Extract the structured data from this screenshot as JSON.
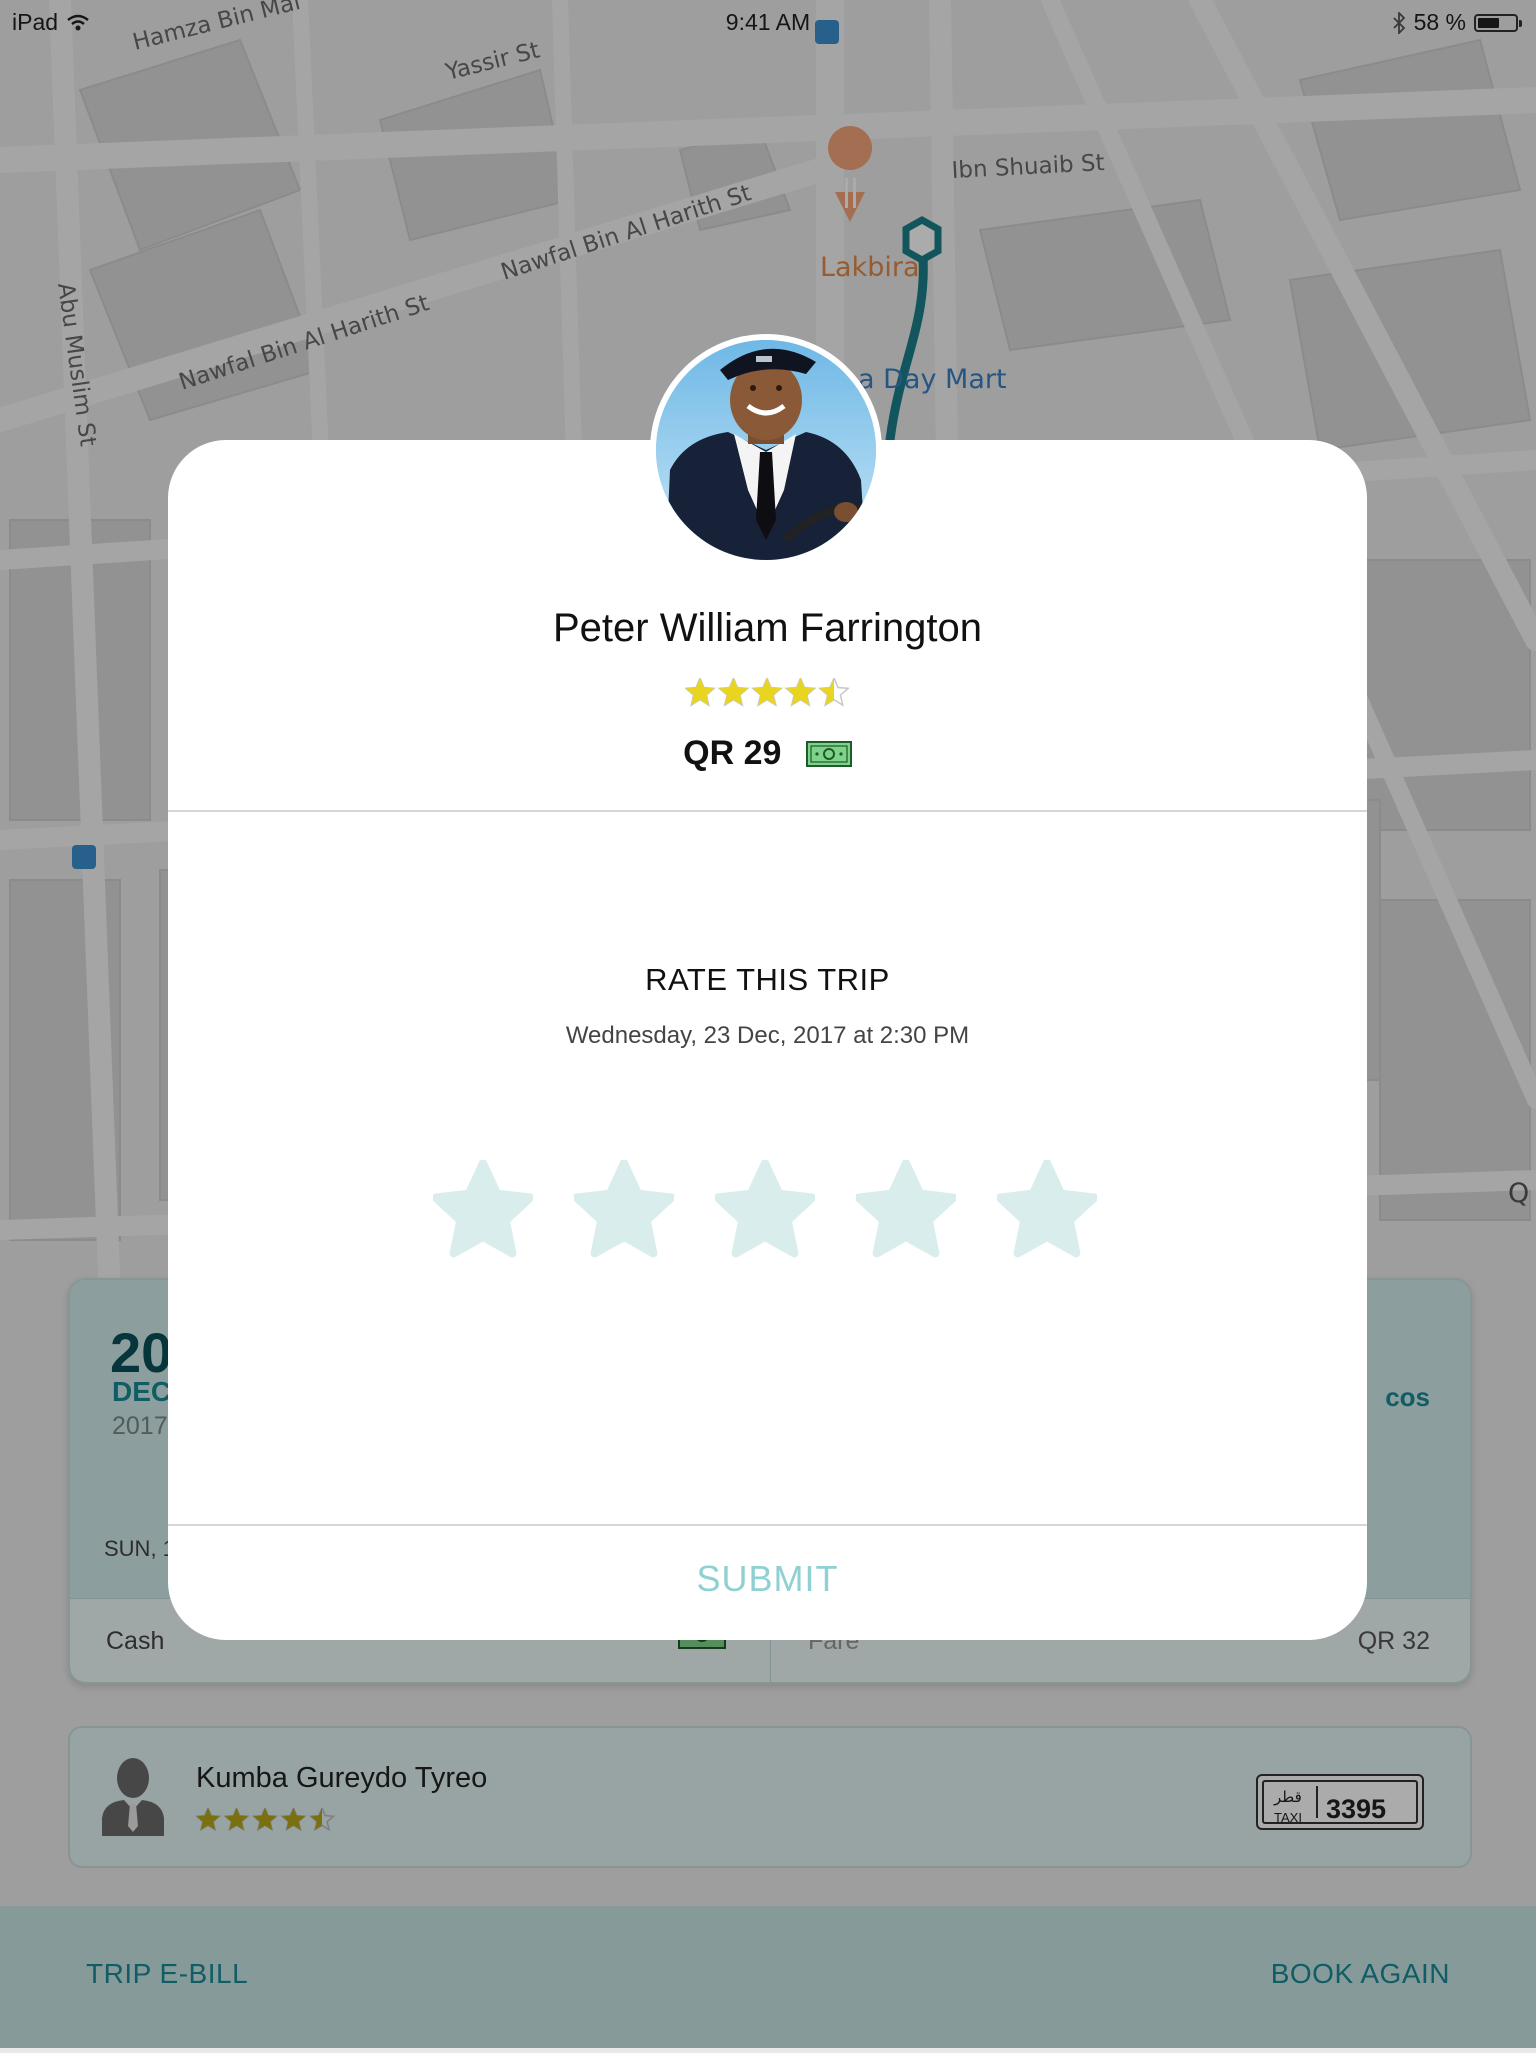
{
  "status_bar": {
    "device": "iPad",
    "time": "9:41 AM",
    "battery": "58 %",
    "battery_level": 0.58
  },
  "map": {
    "streets": [
      "Hamza Bin Mal",
      "Yassir St",
      "Ibn Shuaib St",
      "Nawfal Bin Al Harith St",
      "Nawfal Bin Al Harith St",
      "Abu Muslim St"
    ],
    "poi_restaurant": "Lakbira",
    "poi_store": "a Day Mart",
    "edge_label": "Q"
  },
  "trip_card": {
    "day_number": "20",
    "month": "DEC",
    "year": "2017",
    "weekday": "SUN, 1",
    "destination_partial": "cos",
    "payment_method": "Cash",
    "fare_label": "Fare",
    "fare_value": "QR 32"
  },
  "driver_card": {
    "name": "Kumba Gureydo Tyreo",
    "rating": 4.5,
    "plate_country": "قطر",
    "plate_type": "TAXI",
    "plate_number": "3395"
  },
  "bottom_bar": {
    "left_button": "TRIP E-BILL",
    "right_button": "BOOK AGAIN"
  },
  "modal": {
    "driver_name": "Peter William Farrington",
    "driver_rating": 4.5,
    "fare": "QR 29",
    "payment_icon": "cash-icon",
    "rate_title": "RATE THIS TRIP",
    "trip_datetime": "Wednesday, 23 Dec, 2017 at 2:30 PM",
    "user_rating": 0,
    "max_rating": 5,
    "submit_label": "SUBMIT"
  },
  "colors": {
    "accent": "#188b97",
    "star_filled": "#e9d51f",
    "star_empty": "#d9eded",
    "submit_disabled": "#8fd0d2",
    "route": "#1b7f89"
  }
}
